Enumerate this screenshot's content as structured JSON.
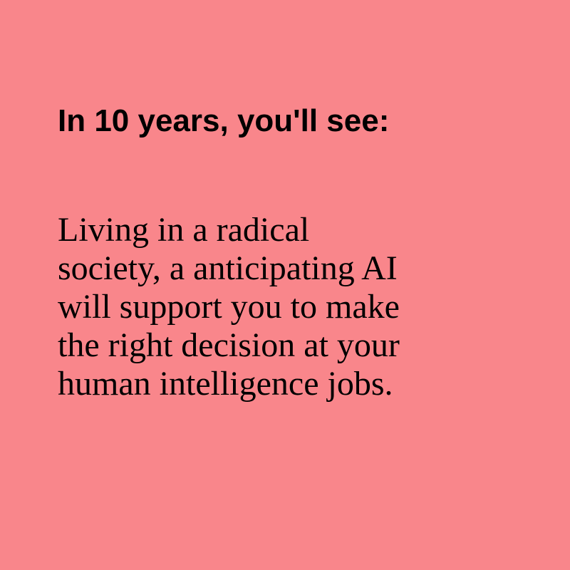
{
  "colors": {
    "background": "#f9868b",
    "text": "#000000"
  },
  "heading": "In 10 years, you'll see:",
  "body_lines": [
    "Living in a radical",
    "society, a anticipating AI",
    "will support you to make",
    "the right decision at your",
    "human intelligence jobs."
  ]
}
